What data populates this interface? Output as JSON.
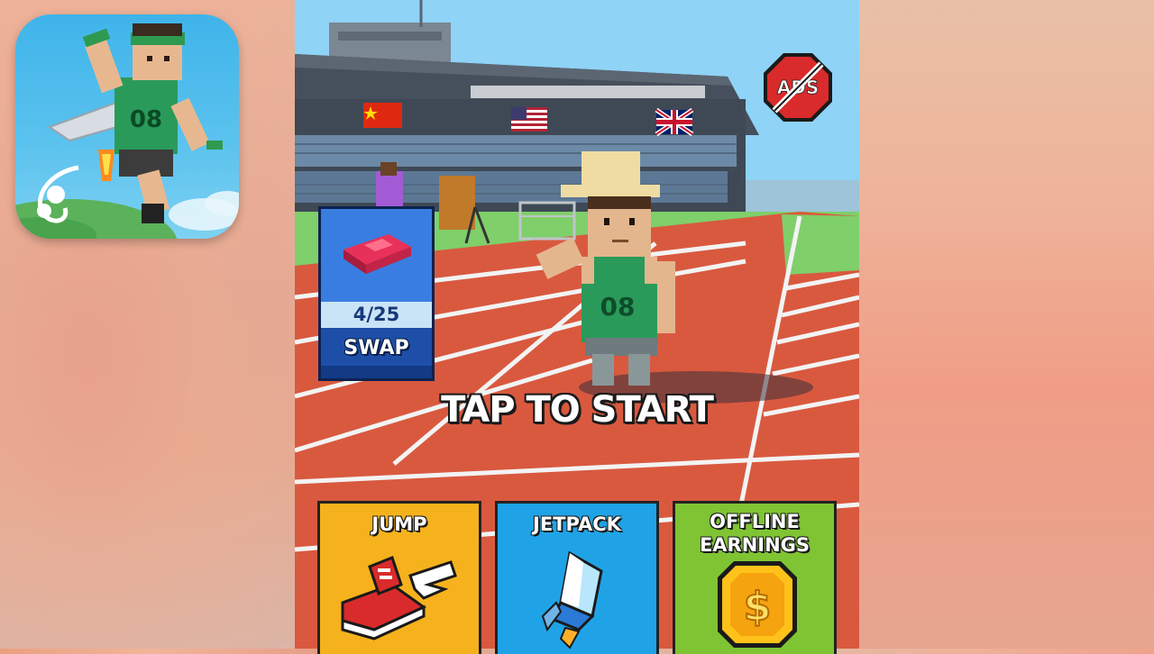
{
  "game": {
    "tap_to_start": "TAP TO START",
    "no_ads_label": "ADS",
    "swap_card": {
      "counter": "4/25",
      "button_label": "SWAP"
    },
    "upgrades": [
      {
        "label": "JUMP"
      },
      {
        "label": "JETPACK"
      },
      {
        "label_line1": "OFFLINE",
        "label_line2": "EARNINGS"
      }
    ],
    "runner_number": "08",
    "icon_runner_number": "08"
  },
  "colors": {
    "track": "#d9593f",
    "sky": "#8fd3f6",
    "grass": "#7fcf6a",
    "jump_card": "#f6b21d",
    "jetpack_card": "#1fa3e6",
    "offline_card": "#7fc433",
    "swap_card": "#1e4fa8",
    "jersey": "#2a9a5a"
  }
}
